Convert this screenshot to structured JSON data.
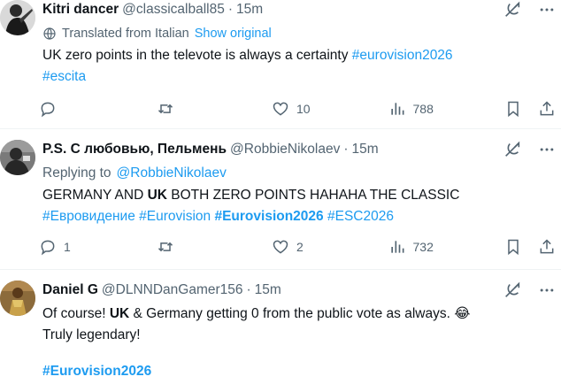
{
  "tweets": [
    {
      "name": "Kitri dancer",
      "handle": "@classicalball85",
      "time": "15m",
      "translated": "Translated from Italian",
      "show_original": "Show original",
      "text": "UK zero points in the televote is always a certainty",
      "tags": [
        "#eurovision2026",
        "#escita"
      ],
      "replies": "",
      "reposts": "",
      "likes": "10",
      "views": "788"
    },
    {
      "name": "P.S. С любовью, Пельмень",
      "handle": "@RobbieNikolaev",
      "time": "15m",
      "replying_prefix": "Replying to",
      "replying_to": "@RobbieNikolaev",
      "text_a": "GERMANY AND ",
      "text_b": "UK",
      "text_c": " BOTH ZERO POINTS HAHAHA THE CLASSIC",
      "tag1": "#Евровидение",
      "tag2": "#Eurovision",
      "tag3": "#Eurovision2026",
      "tag4": "#ESC2026",
      "replies": "1",
      "reposts": "",
      "likes": "2",
      "views": "732"
    },
    {
      "name": "Daniel G",
      "handle": "@DLNNDanGamer156",
      "time": "15m",
      "text_a": "Of course! ",
      "text_b": "UK",
      "text_c": " & Germany getting 0 from the public vote as always. 😂",
      "line2": "Truly legendary!",
      "tag": "#Eurovision2026"
    }
  ],
  "separator": "·",
  "icons": {
    "grok": "grok-icon",
    "more": "more-dots-icon",
    "translate": "translate-globe-icon",
    "reply": "reply-icon",
    "repost": "repost-icon",
    "like": "like-heart-icon",
    "views": "views-chart-icon",
    "bookmark": "bookmark-icon",
    "share": "share-icon"
  },
  "colors": {
    "link": "#1d9bf0",
    "secondary": "#536471",
    "text": "#0f1419"
  }
}
